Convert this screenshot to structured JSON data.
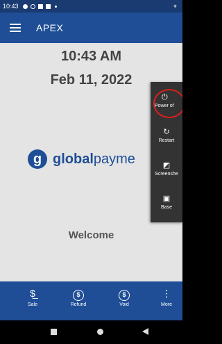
{
  "status_bar": {
    "time": "10:43"
  },
  "app_bar": {
    "title": "APEX"
  },
  "clock": {
    "time": "10:43 AM",
    "date": "Feb 11, 2022"
  },
  "logo": {
    "brand_bold": "global",
    "brand_rest": "payme"
  },
  "welcome": "Welcome",
  "menu": {
    "power": {
      "label": "Power of",
      "icon": "power-icon"
    },
    "restart": {
      "label": "Restart",
      "icon": "restart-icon"
    },
    "screenshot": {
      "label": "Screenshe",
      "icon": "screenshot-icon"
    },
    "base": {
      "label": "Base",
      "icon": "base-icon"
    }
  },
  "actions": {
    "sale": "Sale",
    "refund": "Refund",
    "void": "Void",
    "more": "More"
  },
  "colors": {
    "primary": "#1f4e96",
    "status": "#1a3a72",
    "highlight": "#d8201e"
  }
}
